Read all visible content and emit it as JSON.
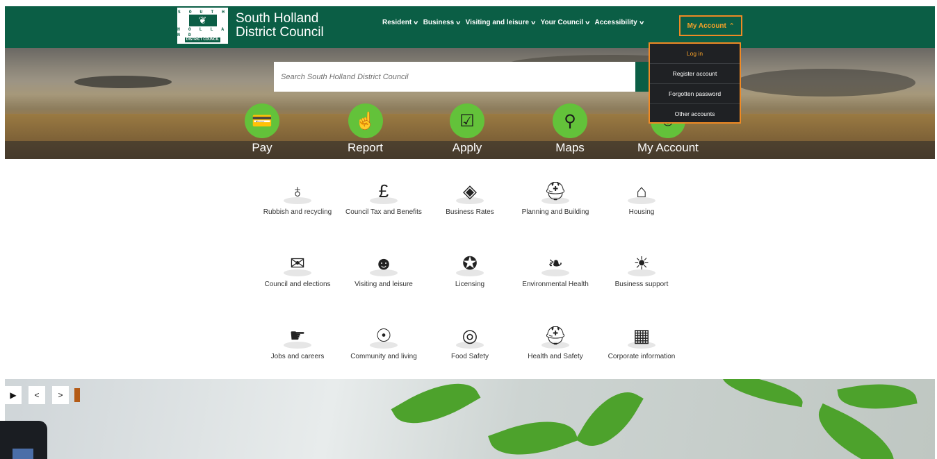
{
  "header": {
    "logo_top": "S O U T H",
    "logo_bottom": "H O L L A N D",
    "logo_dc": "DISTRICT COUNCIL",
    "title_line1": "South Holland",
    "title_line2": "District Council",
    "nav": [
      "Resident",
      "Business",
      "Visiting and leisure",
      "Your Council",
      "Accessibility"
    ],
    "account_label": "My Account",
    "accent": "#f08a24",
    "brand": "#0b5e45"
  },
  "dropdown": {
    "items": [
      "Log in",
      "Register account",
      "Forgotten password",
      "Other accounts"
    ]
  },
  "search": {
    "placeholder": "Search South Holland District Council"
  },
  "quick_links": [
    {
      "label": "Pay",
      "icon": "card-icon"
    },
    {
      "label": "Report",
      "icon": "pointer-icon"
    },
    {
      "label": "Apply",
      "icon": "checkbox-icon"
    },
    {
      "label": "Maps",
      "icon": "map-pin-icon"
    },
    {
      "label": "My Account",
      "icon": "user-icon"
    }
  ],
  "services": [
    {
      "label": "Rubbish and recycling",
      "icon": "rubbish-bag-icon"
    },
    {
      "label": "Council Tax and Benefits",
      "icon": "pound-house-icon"
    },
    {
      "label": "Business Rates",
      "icon": "money-icon"
    },
    {
      "label": "Planning and Building",
      "icon": "hard-hat-gear-icon"
    },
    {
      "label": "Housing",
      "icon": "house-icon"
    },
    {
      "label": "Council and elections",
      "icon": "ballot-box-icon"
    },
    {
      "label": "Visiting and leisure",
      "icon": "theatre-masks-icon"
    },
    {
      "label": "Licensing",
      "icon": "rosette-icon"
    },
    {
      "label": "Environmental Health",
      "icon": "plant-hand-icon"
    },
    {
      "label": "Business support",
      "icon": "lightbulb-icon"
    },
    {
      "label": "Jobs and careers",
      "icon": "handshake-icon"
    },
    {
      "label": "Community and living",
      "icon": "community-icon"
    },
    {
      "label": "Food Safety",
      "icon": "plate-cutlery-icon"
    },
    {
      "label": "Health and Safety",
      "icon": "helmet-goggles-icon"
    },
    {
      "label": "Corporate information",
      "icon": "presentation-board-icon"
    }
  ],
  "carousel": {
    "play": "▶",
    "prev": "<",
    "next": ">"
  }
}
